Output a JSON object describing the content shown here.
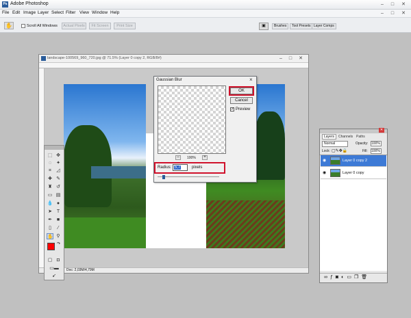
{
  "app": {
    "title": "Adobe Photoshop",
    "logo_text": "Ps",
    "window_controls": [
      "–",
      "□",
      "✕"
    ],
    "right_controls": [
      "–",
      "□",
      "✕"
    ]
  },
  "menubar": {
    "items": [
      "File",
      "Edit",
      "Image",
      "Layer",
      "Select",
      "Filter",
      "View",
      "Window",
      "Help"
    ]
  },
  "options": {
    "scroll_all_windows_label": "Scroll All Windows",
    "buttons": [
      "Actual Pixels",
      "Fit Screen",
      "Print Size"
    ],
    "panel_tabs": [
      "Brushes",
      "Tool Presets",
      "Layer Comps"
    ]
  },
  "document": {
    "title": "landscape-100569_960_720.jpg @ 71.5% (Layer 0 copy 2, RGB/8#)",
    "status": "Doc: 2,03M/4,79M",
    "controls": [
      "–",
      "□",
      "✕"
    ]
  },
  "gaussian_blur": {
    "title": "Gaussian Blur",
    "ok_label": "OK",
    "cancel_label": "Cancel",
    "preview_label": "Preview",
    "preview_checked": true,
    "zoom_minus": "–",
    "zoom_level": "100%",
    "zoom_plus": "+",
    "radius_label": "Radius:",
    "radius_value": "5,7",
    "radius_unit": "pixels"
  },
  "layers_panel": {
    "tabs": [
      "Layers",
      "Channels",
      "Paths"
    ],
    "blend_mode": "Normal",
    "opacity_label": "Opacity:",
    "opacity_value": "100%",
    "lock_label": "Lock:",
    "fill_label": "Fill:",
    "fill_value": "100%",
    "layers": [
      {
        "name": "Layer 0 copy 2",
        "selected": true
      },
      {
        "name": "Layer 0 copy",
        "selected": false
      }
    ]
  },
  "colors": {
    "highlight_red": "#d0112b",
    "foreground_swatch": "#ff0000",
    "selected_layer": "#3d7ad6"
  }
}
